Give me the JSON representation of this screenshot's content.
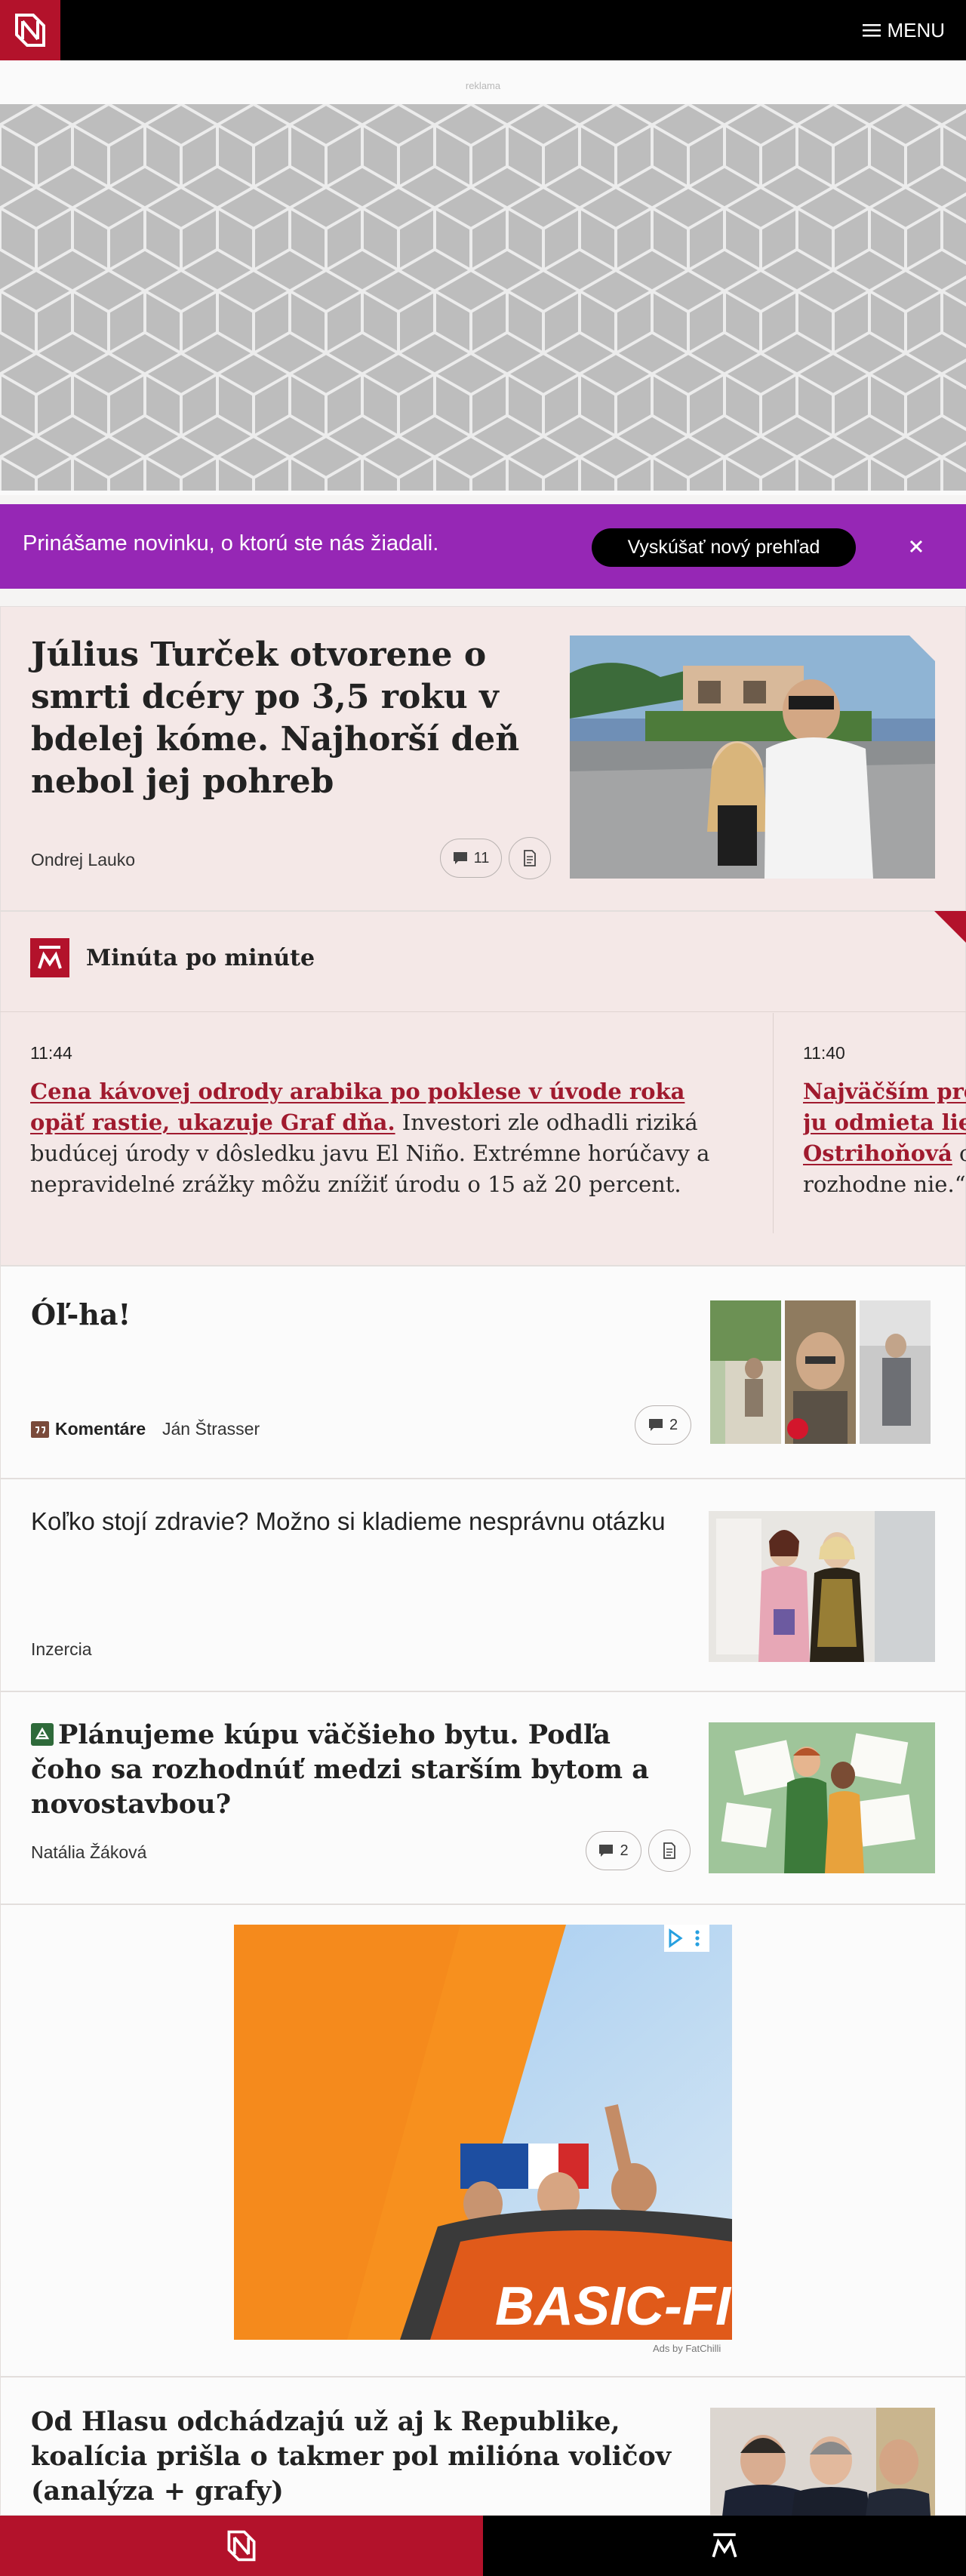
{
  "header": {
    "logo_letter": "N",
    "menu_label": "MENU"
  },
  "ad_top": {
    "label": "reklama"
  },
  "promo": {
    "text": "Prinášame novinku, o ktorú ste nás žiadali.",
    "button_label": "Vyskúšať nový prehľad",
    "color": "#9627b5"
  },
  "lead": {
    "title": "Július Turček otvorene o smrti dcéry po 3,5 roku v bdelej kóme. Najhorší deň nebol jej pohreb",
    "author": "Ondrej Lauko",
    "comments": "11"
  },
  "live": {
    "title": "Minúta po minúte",
    "items": [
      {
        "time": "11:44",
        "link": "Cena kávovej odrody arabika po poklese v úvode roka opäť rastie, ukazuje Graf dňa.",
        "text": " Investori zle odhadli riziká budúcej úrody v dôsledku javu El Niño. Extrémne horúčavy a nepravidelné zrážky môžu znížiť úrodu o 15 až 20 percent."
      },
      {
        "time": "11:40",
        "link1": "Najväčším prob",
        "link2": "ju odmieta lieč",
        "link3": "Ostrihoňová",
        "text3": " o",
        "text4": "rozhodne nie.“"
      }
    ]
  },
  "articles": [
    {
      "title": "Óľ-ha!",
      "category": "Komentáre",
      "author": "Ján Štrasser",
      "comments": "2"
    },
    {
      "title": "Koľko stojí zdravie? Možno si kladieme nesprávnu otázku",
      "label": "Inzercia"
    },
    {
      "title": "Plánujeme kúpu väčšieho bytu. Podľa čoho sa rozhodnúť medzi starším bytom a novostavbou?",
      "author": "Natália Žáková",
      "comments": "2"
    }
  ],
  "ad_mid": {
    "brand": "BASIC-FIT",
    "credit": "Ads by FatChilli"
  },
  "last_article": {
    "title": "Od Hlasu odchádzajú už aj k Republike, koalícia prišla o takmer pol milióna voličov (analýza + grafy)"
  },
  "colors": {
    "brand_red": "#b3122b",
    "link_red": "#a01a2e",
    "pink_bg": "#f4e8e7"
  }
}
